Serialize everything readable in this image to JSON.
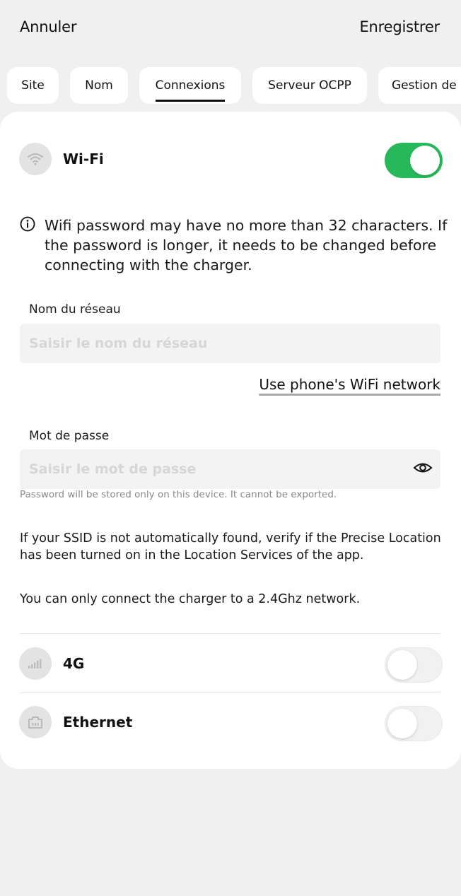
{
  "header": {
    "cancel_label": "Annuler",
    "save_label": "Enregistrer"
  },
  "tabs": [
    {
      "label": "Site",
      "active": false
    },
    {
      "label": "Nom",
      "active": false
    },
    {
      "label": "Connexions",
      "active": true
    },
    {
      "label": "Serveur OCPP",
      "active": false
    },
    {
      "label": "Gestion de",
      "active": false
    }
  ],
  "wifi": {
    "title": "Wi-Fi",
    "enabled": true,
    "info": "Wifi password may have no more than 32 characters. If the password is longer, it needs to be changed before connecting with the charger.",
    "network_label": "Nom du réseau",
    "network_value": "",
    "network_placeholder": "Saisir le nom du réseau",
    "use_phone_network_label": "Use phone's WiFi network",
    "password_label": "Mot de passe",
    "password_value": "",
    "password_placeholder": "Saisir le mot de passe",
    "password_hint": "Password will be stored only on this device. It cannot be exported.",
    "ssid_note": "If your SSID is not automatically found, verify if the Precise Location has been turned on in the Location Services of the app.",
    "band_note": "You can only connect the charger to a 2.4Ghz network."
  },
  "cellular": {
    "title": "4G",
    "enabled": false
  },
  "ethernet": {
    "title": "Ethernet",
    "enabled": false
  },
  "colors": {
    "toggle_on": "#28b85c",
    "background": "#f0f0f0",
    "card": "#ffffff"
  },
  "icons": {
    "wifi": "wifi-icon",
    "cellular": "cellular-signal-icon",
    "ethernet": "ethernet-port-icon",
    "info": "info-icon",
    "eye": "eye-icon"
  }
}
